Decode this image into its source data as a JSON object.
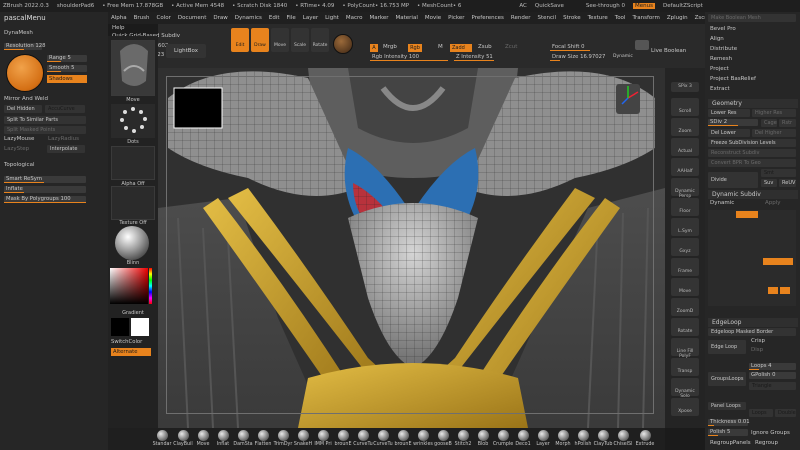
{
  "titlebar": {
    "items": [
      "ZBrush 2022.0.3",
      "shoulderPad6",
      "• Free Mem 17.878GB",
      "• Active Mem 4548",
      "• Scratch Disk 1840",
      "• RTime• 4.09",
      "• PolyCount• 16.753 MP",
      "• MeshCount• 6",
      "AC",
      "QuickSave",
      "See-through 0",
      "Menus",
      "DefaultZScript"
    ]
  },
  "menubar": [
    "Alpha",
    "Brush",
    "Color",
    "Document",
    "Draw",
    "Dynamics",
    "Edit",
    "File",
    "Layer",
    "Light",
    "Macro",
    "Marker",
    "Material",
    "Movie",
    "Picker",
    "Preferences",
    "Render",
    "Stencil",
    "Stroke",
    "Texture",
    "Tool",
    "Transform",
    "Zplugin",
    "Zscript",
    "pascalMenu"
  ],
  "left": {
    "title": "pascalMenu",
    "dynamesh": "DynaMesh",
    "resolution_label": "Resolution",
    "resolution_value": "128",
    "range_label": "Range",
    "range_value": "5",
    "smooth_label": "Smooth",
    "smooth_value": "5",
    "shadows": "Shadows",
    "mirror_weld": "Mirror And Weld",
    "del_hidden": "Del Hidden",
    "accucurve": "AccuCurve",
    "split_similar": "Split To Similar Parts",
    "split_masked": "Split Masked Points",
    "lazymouse": "LazyMouse",
    "lazyradius": "LazyRadius",
    "lazystep": "LazyStep",
    "interpolate": "Interpolate",
    "topological": "Topological",
    "smart_resym": "Smart ReSym",
    "inflate": "Inflate",
    "mask_by_poly": "Mask By Polygroups",
    "mask_by_poly_value": "100"
  },
  "header": {
    "help": "Help",
    "quick_grid": "Quick Grid-Based Subdiv",
    "active_points": "ActivePoints: 12,602",
    "total_points": "TotalPoints: 16.223 Mil",
    "lightbox": "LightBox"
  },
  "tools": [
    {
      "name": "edit-tool",
      "label": "Edit",
      "active": true
    },
    {
      "name": "draw-tool",
      "label": "Draw",
      "active": true
    },
    {
      "name": "move-tool",
      "label": "Move",
      "active": false
    },
    {
      "name": "scale-tool",
      "label": "Scale",
      "active": false
    },
    {
      "name": "rotate-tool",
      "label": "Rotate",
      "active": false
    }
  ],
  "draw_settings": {
    "a": "A",
    "mrgb": "Mrgb",
    "rgb": "Rgb",
    "m": "M",
    "zadd": "Zadd",
    "zsub": "Zsub",
    "zcut": "Zcut",
    "rgb_intensity_label": "Rgb Intensity",
    "rgb_intensity_value": "100",
    "z_intensity_label": "Z Intensity",
    "z_intensity_value": "51",
    "focal_shift_label": "Focal Shift",
    "focal_shift_value": "0",
    "draw_size_label": "Draw Size",
    "draw_size_value": "16.97027",
    "dynamic": "Dynamic",
    "live_boolean": "Live Boolean"
  },
  "tray": {
    "move": "Move",
    "dots": "Dots",
    "alpha_off": "Alpha Off",
    "texture_off": "Texture Off",
    "blinn": "Blinn",
    "gradient": "Gradient",
    "switch_color": "SwitchColor",
    "alternate": "Alternate"
  },
  "shelf": [
    "SPix 3",
    "Scroll",
    "Zoom",
    "Actual",
    "AAHalf",
    "Dynamic Persp",
    "Floor",
    "L.Sym",
    "Gxyz",
    "Frame",
    "Move",
    "ZoomD",
    "Rotate",
    "Line Fill PolyF",
    "Transp",
    "Dynamic Solo",
    "Xpose"
  ],
  "right": {
    "make_boolean": "Make Boolean Mesh",
    "bevel_pro": "Bevel Pro",
    "align": "Align",
    "distribute": "Distribute",
    "remesh": "Remesh",
    "project": "Project",
    "project_basrelief": "Project BasRelief",
    "extract": "Extract",
    "geometry": "Geometry",
    "lower_res": "Lower Res",
    "higher_res": "Higher Res",
    "sdiv_label": "SDiv",
    "sdiv_value": "2",
    "cage": "Cage",
    "rstr": "Rstr",
    "del_lower": "Del Lower",
    "del_higher": "Del Higher",
    "freeze_subdiv": "Freeze SubDivision Levels",
    "reconstruct": "Reconstruct Subdiv",
    "convert_bpr": "Convert BPR To Geo",
    "divide": "Divide",
    "smt": "Smt",
    "suv": "Suv",
    "reuv": "ReUV",
    "dynamic_subdiv": "Dynamic Subdiv",
    "dynamic": "Dynamic",
    "apply": "Apply",
    "edgeloop": "EdgeLoop",
    "edgeloop_masked": "Edgeloop Masked Border",
    "edge_loop": "Edge Loop",
    "crisp": "Crisp",
    "disp": "Disp",
    "loops_label": "Loops",
    "loops_value": "4",
    "groupsloops": "GroupsLoops",
    "gpolish_label": "GPolish",
    "gpolish_value": "0",
    "triangle": "Triangle",
    "panel_loops": "Panel Loops",
    "loops2_label": "Loops",
    "double": "Double",
    "thickness_label": "Thickness",
    "thickness_value": "0.01",
    "polish_label": "Polish",
    "polish_value": "5",
    "ignore_groups": "Ignore Groups",
    "regroup_panels": "RegroupPanels",
    "regroup": "Regroup"
  },
  "brushes": [
    "Standar",
    "ClayBuil",
    "Move",
    "Inflat",
    "DamSta",
    "Flatten",
    "TrimDyr",
    "SnakeH",
    "IMM Pri",
    "brounE",
    "CurveTu",
    "CurveTu",
    "brounE",
    "wrinkles",
    "gooseB",
    "Stitch2",
    "Blob",
    "Crumple",
    "Deco1",
    "Layer",
    "Morph",
    "hPolish",
    "ClayTub",
    "ChiselSl",
    "Extrude"
  ],
  "colors": {
    "accent": "#e8831d",
    "mesh_gold": "#c8a22f",
    "mesh_blue": "#2c6fb3",
    "mesh_red": "#b8323c",
    "mesh_gray": "#7d7d7d"
  }
}
